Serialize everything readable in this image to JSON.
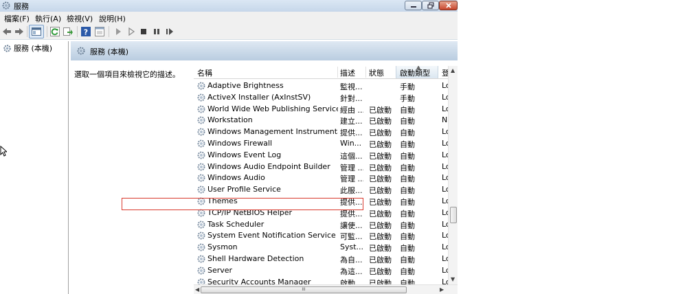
{
  "window": {
    "title": "服務"
  },
  "menu": [
    {
      "label": "檔案(F)"
    },
    {
      "label": "執行(A)"
    },
    {
      "label": "檢視(V)"
    },
    {
      "label": "說明(H)"
    }
  ],
  "tree": {
    "root_label": "服務 (本機)"
  },
  "pane": {
    "title": "服務 (本機)",
    "description": "選取一個項目來檢視它的描述。"
  },
  "columns": [
    {
      "label": "名稱"
    },
    {
      "label": "描述"
    },
    {
      "label": "狀態"
    },
    {
      "label": "啟動類型"
    },
    {
      "label": "登"
    }
  ],
  "services": [
    {
      "name": "Adaptive Brightness",
      "desc": "監視...",
      "status": "",
      "startup": "手動",
      "logon": "Lo"
    },
    {
      "name": "ActiveX Installer (AxInstSV)",
      "desc": "針對...",
      "status": "",
      "startup": "手動",
      "logon": "Lo"
    },
    {
      "name": "World Wide Web Publishing Service",
      "desc": "經由 ...",
      "status": "已啟動",
      "startup": "自動",
      "logon": "Lo"
    },
    {
      "name": "Workstation",
      "desc": "建立...",
      "status": "已啟動",
      "startup": "自動",
      "logon": "N"
    },
    {
      "name": "Windows Management Instrumentation",
      "desc": "提供...",
      "status": "已啟動",
      "startup": "自動",
      "logon": "Lo"
    },
    {
      "name": "Windows Firewall",
      "desc": "Win...",
      "status": "已啟動",
      "startup": "自動",
      "logon": "Lo"
    },
    {
      "name": "Windows Event Log",
      "desc": "這個...",
      "status": "已啟動",
      "startup": "自動",
      "logon": "Lo"
    },
    {
      "name": "Windows Audio Endpoint Builder",
      "desc": "管理 ...",
      "status": "已啟動",
      "startup": "自動",
      "logon": "Lo"
    },
    {
      "name": "Windows Audio",
      "desc": "管理 ...",
      "status": "已啟動",
      "startup": "自動",
      "logon": "Lo"
    },
    {
      "name": "User Profile Service",
      "desc": "此服...",
      "status": "已啟動",
      "startup": "自動",
      "logon": "Lo"
    },
    {
      "name": "Themes",
      "desc": "提供...",
      "status": "已啟動",
      "startup": "自動",
      "logon": "Lo"
    },
    {
      "name": "TCP/IP NetBIOS Helper",
      "desc": "提供...",
      "status": "已啟動",
      "startup": "自動",
      "logon": "Lo"
    },
    {
      "name": "Task Scheduler",
      "desc": "讓使...",
      "status": "已啟動",
      "startup": "自動",
      "logon": "Lo"
    },
    {
      "name": "System Event Notification Service",
      "desc": "可監...",
      "status": "已啟動",
      "startup": "自動",
      "logon": "Lo"
    },
    {
      "name": "Sysmon",
      "desc": "Syst...",
      "status": "已啟動",
      "startup": "自動",
      "logon": "Lo",
      "highlighted": true
    },
    {
      "name": "Shell Hardware Detection",
      "desc": "為自...",
      "status": "已啟動",
      "startup": "自動",
      "logon": "Lo"
    },
    {
      "name": "Server",
      "desc": "為這...",
      "status": "已啟動",
      "startup": "自動",
      "logon": "Lo"
    },
    {
      "name": "Security Accounts Manager",
      "desc": "啟動...",
      "status": "已啟動",
      "startup": "自動",
      "logon": "Lo"
    }
  ],
  "scrollbar": {
    "h_thumb_grip": "III"
  },
  "colors": {
    "highlight_border": "#d9382c",
    "header_gradient_top": "#dfe9f3",
    "header_gradient_bottom": "#b9cde0"
  }
}
